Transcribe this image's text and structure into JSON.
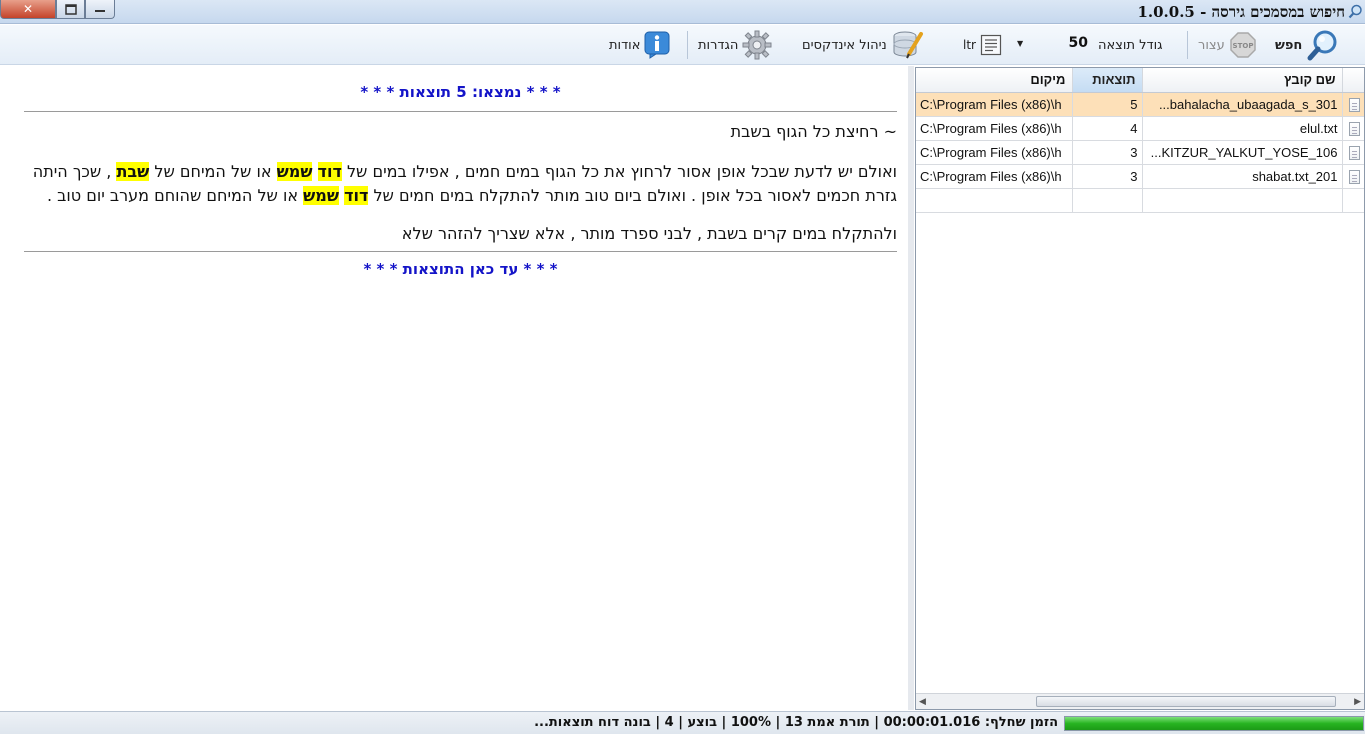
{
  "window": {
    "title": "חיפוש במסמכים גירסה - 1.0.0.5"
  },
  "toolbar": {
    "search_label": "חפש",
    "stop_label": "עצור",
    "result_size_label": "גודל תוצאה",
    "result_size_value": "50",
    "ltr_label": "ltr",
    "index_manage_label": "ניהול אינדקסים",
    "settings_label": "הגדרות",
    "about_label": "אודות"
  },
  "results": {
    "header": "* * * נמצאו: 5 תוצאות * * *",
    "topic": "~ רחיצת כל הגוף בשבת",
    "para1": {
      "t1": "ואולם יש לדעת שבכל אופן אסור לרחוץ את כל הגוף במים חמים , אפילו במים של ",
      "h1": "דוד",
      "t2": " ",
      "h2": "שמש",
      "t3": " או של המיחם של ",
      "h3": "שבת",
      "t4": " , שכך היתה גזרת חכמים לאסור בכל אופן . ואולם ביום טוב מותר להתקלח במים חמים של ",
      "h4": "דוד",
      "t5": " ",
      "h5": "שמש",
      "t6": " או של המיחם שהוחם מערב יום טוב ."
    },
    "para2": "ולהתקלח במים קרים בשבת , לבני ספרד מותר , אלא שצריך להזהר שלא",
    "footer": "* * * עד כאן התוצאות * * *"
  },
  "files": {
    "columns": [
      "שם קובץ",
      "תוצאות",
      "מיקום"
    ],
    "rows": [
      {
        "name": "bahalacha_ubaagada_s_301...",
        "count": "5",
        "location": "C:\\Program Files (x86)\\h"
      },
      {
        "name": "elul.txt",
        "count": "4",
        "location": "C:\\Program Files (x86)\\h"
      },
      {
        "name": "KITZUR_YALKUT_YOSE_106...",
        "count": "3",
        "location": "C:\\Program Files (x86)\\h"
      },
      {
        "name": "shabat.txt_201",
        "count": "3",
        "location": "C:\\Program Files (x86)\\h"
      }
    ]
  },
  "status": {
    "text": "הזמן שחלף: 00:00:01.016 | תורת אמת 13 | 100% | בוצע | 4 | בונה דוח תוצאות...",
    "progress": 1.0
  },
  "colors": {
    "result_text": "#1414c8",
    "highlight": "#ffff00",
    "selected_row": "#fde0b8",
    "progress": "#27b421"
  }
}
